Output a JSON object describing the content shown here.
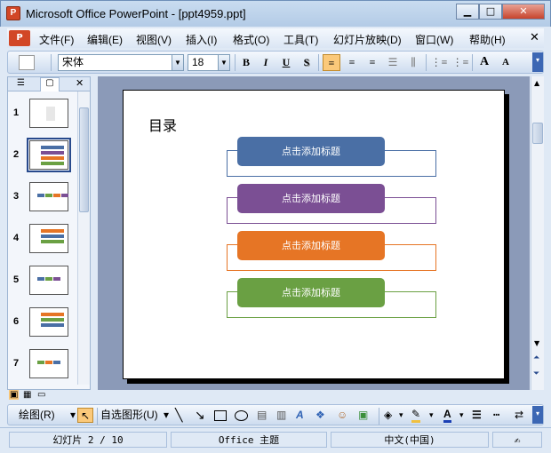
{
  "window": {
    "title": "Microsoft Office PowerPoint - [ppt4959.ppt]",
    "app_icon": "powerpoint-icon"
  },
  "menu": [
    "文件(F)",
    "编辑(E)",
    "视图(V)",
    "插入(I)",
    "格式(O)",
    "工具(T)",
    "幻灯片放映(D)",
    "窗口(W)",
    "帮助(H)"
  ],
  "toolbar": {
    "font": "宋体",
    "size": "18",
    "bold": "B",
    "italic": "I",
    "underline": "U",
    "shadow": "S",
    "grow": "A",
    "shrink": "A"
  },
  "slides": [
    "1",
    "2",
    "3",
    "4",
    "5",
    "6",
    "7"
  ],
  "selected_slide": 2,
  "slide": {
    "heading": "目录",
    "cards": [
      {
        "label": "点击添加标题",
        "color": "#4a6fa5"
      },
      {
        "label": "点击添加标题",
        "color": "#7b4f94"
      },
      {
        "label": "点击添加标题",
        "color": "#e67525"
      },
      {
        "label": "点击添加标题",
        "color": "#6aa043"
      }
    ]
  },
  "drawbar": {
    "draw": "绘图(R)",
    "autoshapes": "自选图形(U)"
  },
  "status": {
    "slide": "幻灯片 2 / 10",
    "theme": "Office 主题",
    "lang": "中文(中国)"
  }
}
